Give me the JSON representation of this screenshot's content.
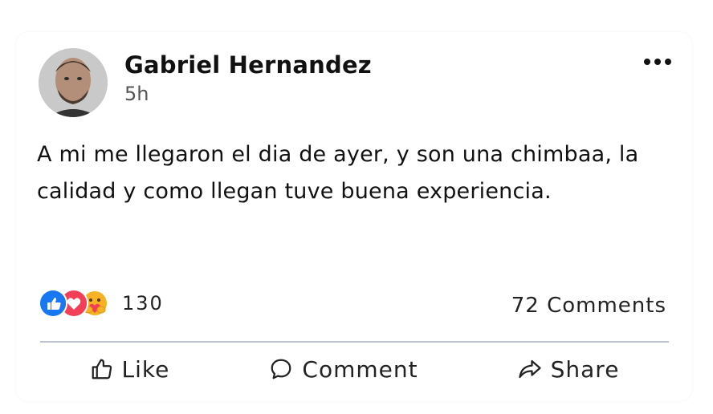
{
  "post": {
    "author": "Gabriel Hernandez",
    "time": "5h",
    "text": "A mi me llegaron el dia de ayer, y son una chimbaa, la calidad y como llegan tuve buena experiencia.",
    "reactions": {
      "icons": [
        "like-icon",
        "love-icon",
        "care-icon"
      ],
      "count": "130"
    },
    "comments_count": "72 Comments"
  },
  "actions": {
    "like": "Like",
    "comment": "Comment",
    "share": "Share"
  },
  "colors": {
    "like_blue": "#1877f2",
    "love_red": "#f33e58",
    "care_yellow": "#f7b125",
    "divider": "#b9c3d3"
  }
}
